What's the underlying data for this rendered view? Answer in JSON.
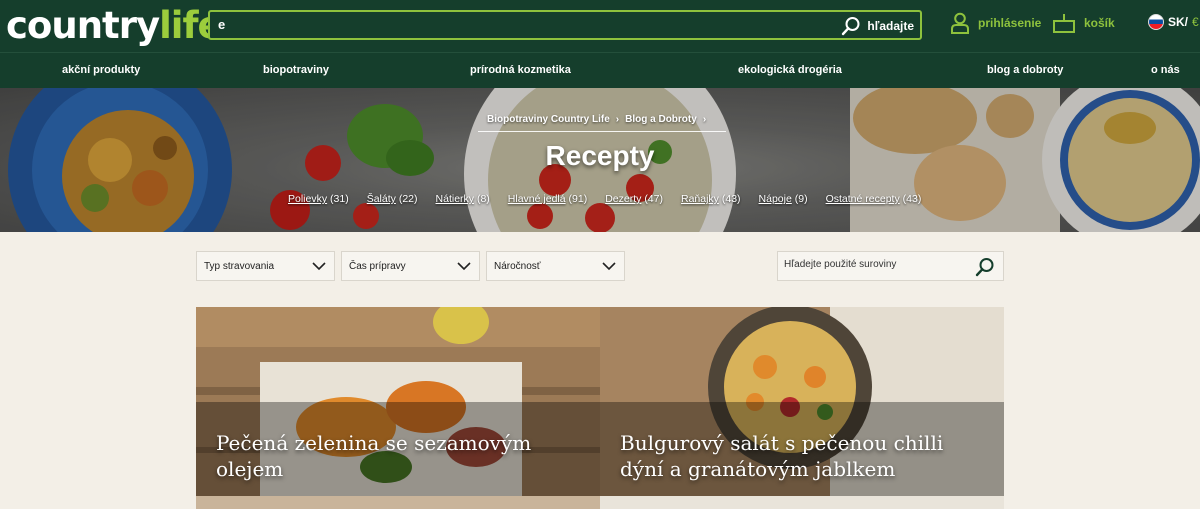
{
  "header": {
    "logo": {
      "country": "country",
      "life": "life"
    },
    "search": {
      "value": "e",
      "button_label": "hľadajte"
    },
    "login_label": "prihlásenie",
    "cart_label": "košík",
    "lang": {
      "code": "SK/",
      "currency": "€"
    }
  },
  "nav": [
    "akční produkty",
    "biopotraviny",
    "prírodná kozmetika",
    "ekologická drogéria",
    "blog a dobroty",
    "o nás"
  ],
  "hero": {
    "breadcrumb": [
      "Biopotraviny Country Life",
      "Blog a Dobroty"
    ],
    "title": "Recepty",
    "categories": [
      {
        "name": "Polievky",
        "count": "(31)"
      },
      {
        "name": "Šaláty",
        "count": "(22)"
      },
      {
        "name": "Nátierky",
        "count": "(8)"
      },
      {
        "name": "Hlavné jedlá",
        "count": "(91)"
      },
      {
        "name": "Dezerty",
        "count": "(47)"
      },
      {
        "name": "Raňajky",
        "count": "(43)"
      },
      {
        "name": "Nápoje",
        "count": "(9)"
      },
      {
        "name": "Ostatné recepty",
        "count": "(43)"
      }
    ]
  },
  "filters": {
    "type": "Typ stravovania",
    "time": "Čas prípravy",
    "difficulty": "Náročnosť",
    "ingredients_placeholder": "Hľadejte použité suroviny"
  },
  "recipes": [
    {
      "title": "Pečená zelenina se sezamovým olejem"
    },
    {
      "title": "Bulgurový salát s pečenou chilli dýní a granátovým jablkem"
    }
  ],
  "colors": {
    "brand_dark": "#153e2c",
    "brand_green": "#8ec23d",
    "page_bg": "#f3efe7"
  }
}
